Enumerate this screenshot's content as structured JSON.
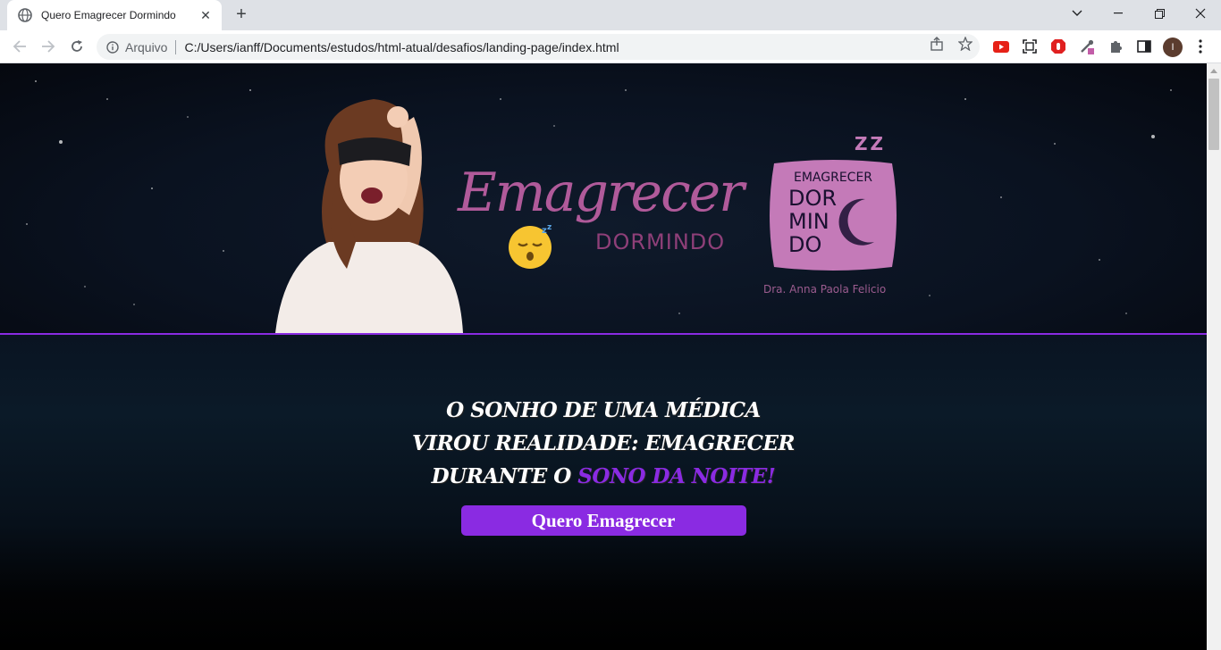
{
  "browser": {
    "tab_title": "Quero Emagrecer Dormindo",
    "omnibox_scheme": "Arquivo",
    "omnibox_url": "C:/Users/ianff/Documents/estudos/html-atual/desafios/landing-page/index.html",
    "profile_initial": "I"
  },
  "header": {
    "logo_script": "Emagrecer",
    "logo_sub": "DORMINDO",
    "badge_line1": "EMAGRECER",
    "badge_line2": "DOR",
    "badge_line3": "MIN",
    "badge_line4": "DO",
    "badge_zz": "Z Z",
    "doctor": "Dra. Anna Paola Felicio"
  },
  "hero": {
    "headline_line1": "O SONHO DE UMA MÉDICA",
    "headline_line2": "VIROU REALIDADE: EMAGRECER",
    "headline_line3_prefix": "DURANTE O ",
    "headline_line3_accent": "SONO DA NOITE!",
    "cta_label": "Quero Emagrecer"
  },
  "colors": {
    "accent": "#8a2be2",
    "logo_pink": "#b05a9a",
    "badge_pink": "#c47ab8"
  }
}
